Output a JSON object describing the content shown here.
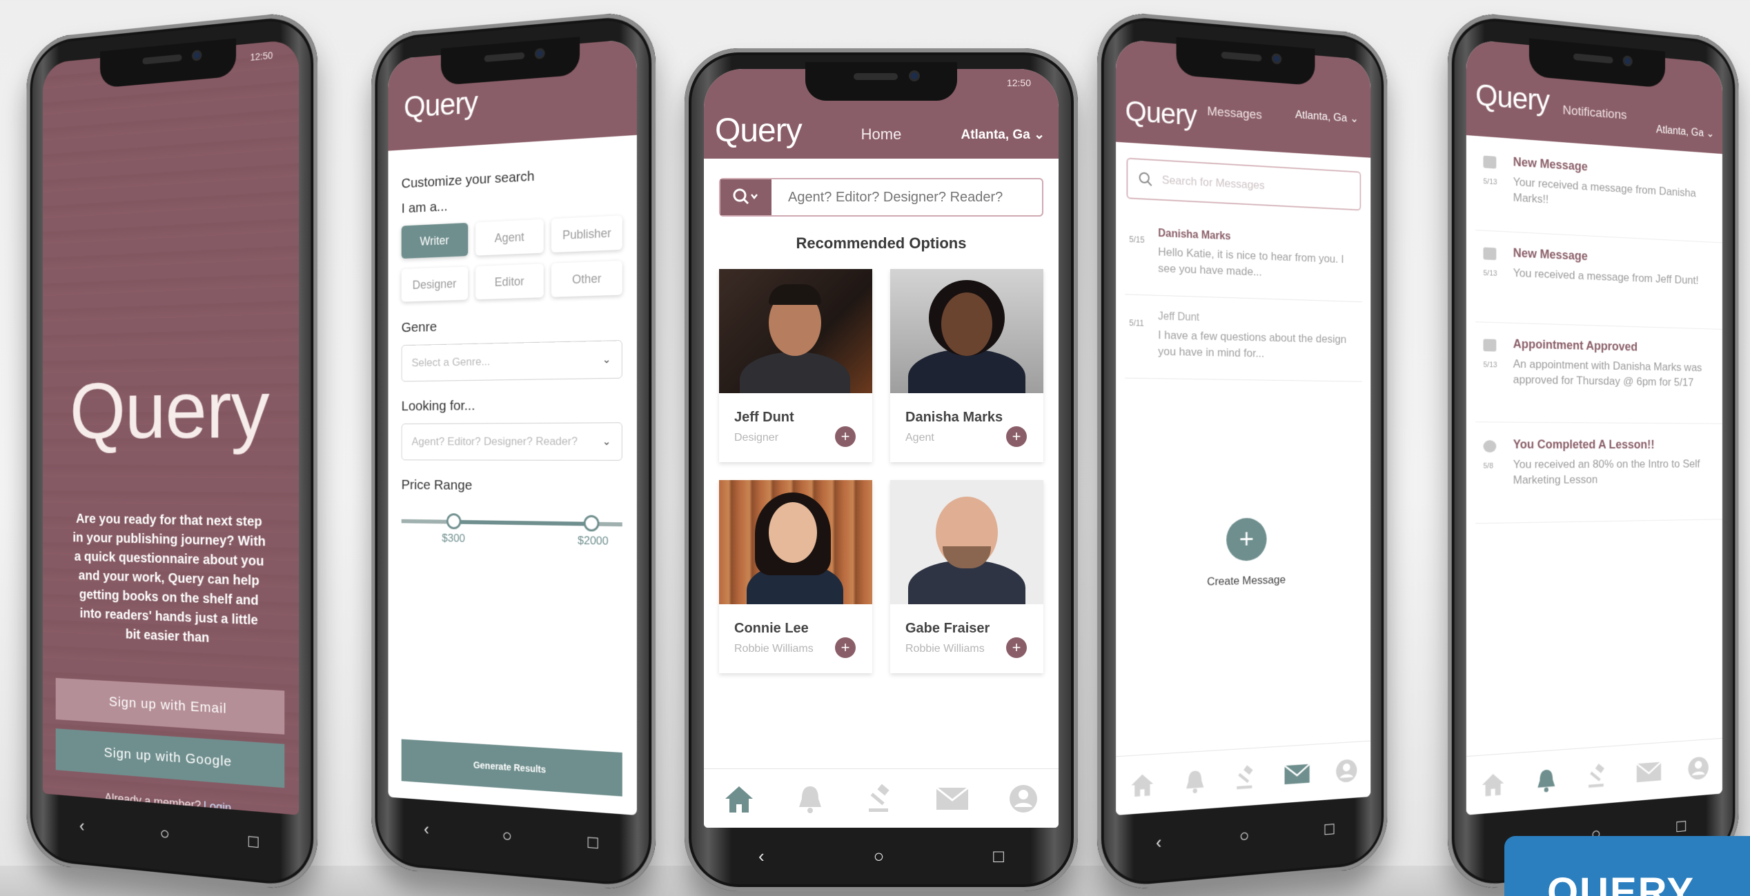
{
  "colors": {
    "mauve": "#8a5e68",
    "teal": "#6f8f8e",
    "rose": "#b58f97",
    "badge": "#2b7fbf"
  },
  "brand": "Query",
  "status_time": "12:50",
  "welcome": {
    "pitch": "Are you ready for that next step in your publishing journey? With a quick questionnaire about you and your work, Query can help getting books on the shelf and into readers' hands just a little bit easier than",
    "email_button": "Sign up with Email",
    "google_button": "Sign up with Google",
    "login_prompt": "Already a member?",
    "login_link": "Login"
  },
  "customize": {
    "heading": "Customize your search",
    "iam": "I am a...",
    "roles": [
      "Writer",
      "Agent",
      "Publisher",
      "Designer",
      "Editor",
      "Other"
    ],
    "selected_role": "Writer",
    "genre_label": "Genre",
    "genre_placeholder": "Select a Genre...",
    "looking_label": "Looking for...",
    "looking_placeholder": "Agent? Editor? Designer? Reader?",
    "price_label": "Price Range",
    "price_min": "$300",
    "price_max": "$2000",
    "generate_button": "Generate Results"
  },
  "home": {
    "title": "Home",
    "location": "Atlanta, Ga",
    "search_placeholder": "Agent? Editor? Designer? Reader?",
    "recommended": "Recommended Options",
    "people": [
      {
        "name": "Jeff Dunt",
        "role": "Designer"
      },
      {
        "name": "Danisha Marks",
        "role": "Agent"
      },
      {
        "name": "Connie Lee",
        "role": "Robbie Williams"
      },
      {
        "name": "Gabe Fraiser",
        "role": "Robbie Williams"
      }
    ],
    "tabs": [
      "home-icon",
      "bell-icon",
      "gavel-icon",
      "mail-icon",
      "profile-icon"
    ]
  },
  "messages": {
    "title": "Messages",
    "location": "Atlanta, Ga",
    "search_placeholder": "Search for Messages",
    "items": [
      {
        "time": "5/15",
        "from": "Danisha Marks",
        "body": "Hello Katie, it is nice to hear from you. I see you have made..."
      },
      {
        "time": "5/11",
        "from": "Jeff Dunt",
        "body": "I have a few questions about the design you have in mind for..."
      }
    ],
    "create_label": "Create Message"
  },
  "notifications": {
    "title": "Notifications",
    "location": "Atlanta, Ga",
    "items": [
      {
        "time": "5/13",
        "title": "New Message",
        "body": "Your received a message from Danisha Marks!!"
      },
      {
        "time": "5/13",
        "title": "New Message",
        "body": "You received a message from Jeff Dunt!"
      },
      {
        "time": "5/13",
        "title": "Appointment Approved",
        "body": "An appointment with Danisha Marks was approved for Thursday @ 6pm for 5/17"
      },
      {
        "time": "5/8",
        "title": "You Completed A Lesson!!",
        "body": "You received an 80% on the Intro to Self Marketing Lesson"
      }
    ]
  },
  "badge": "QUERY"
}
